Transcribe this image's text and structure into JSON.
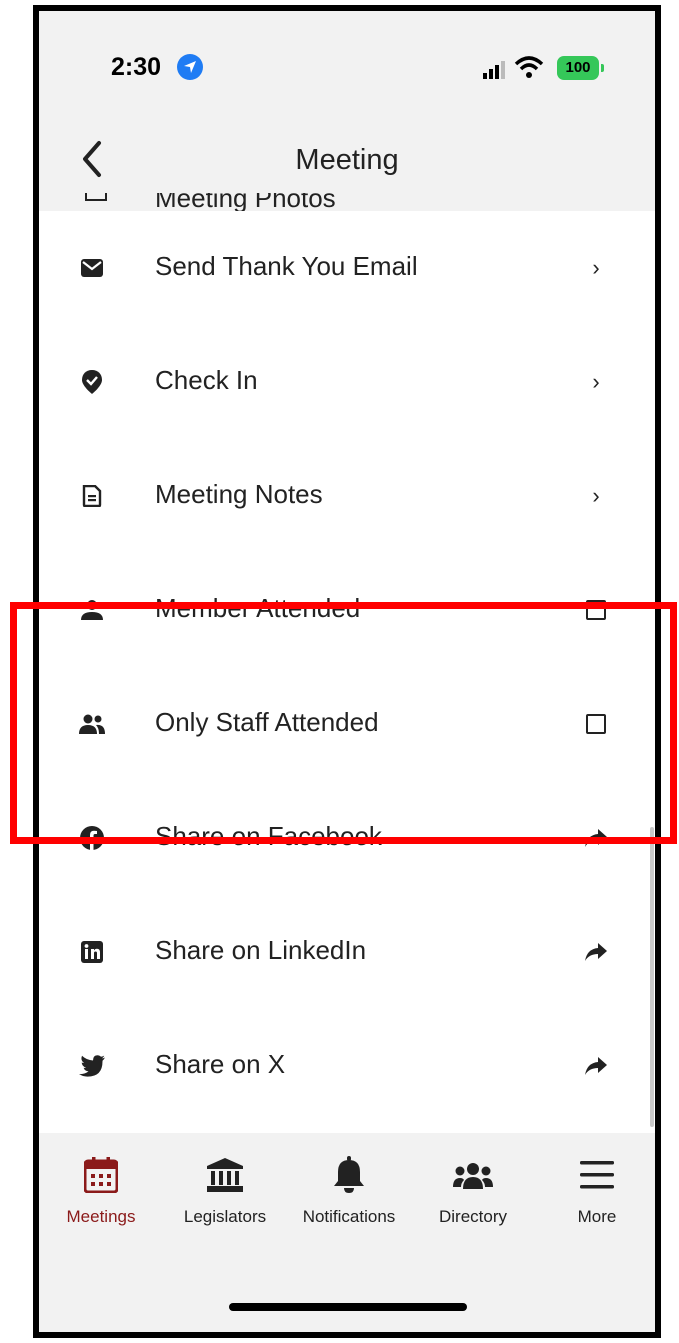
{
  "status_bar": {
    "time": "2:30",
    "battery": "100"
  },
  "nav": {
    "title": "Meeting",
    "partial_item": "Meeting Photos"
  },
  "items": [
    {
      "label": "Send Thank You Email",
      "icon": "envelope-icon",
      "trailing": "chevron"
    },
    {
      "label": "Check In",
      "icon": "location-pin-check-icon",
      "trailing": "chevron"
    },
    {
      "label": "Meeting Notes",
      "icon": "document-icon",
      "trailing": "chevron"
    },
    {
      "label": "Member Attended",
      "icon": "person-icon",
      "trailing": "checkbox",
      "checked": false
    },
    {
      "label": "Only Staff Attended",
      "icon": "people-icon",
      "trailing": "checkbox",
      "checked": false
    },
    {
      "label": "Share on Facebook",
      "icon": "facebook-icon",
      "trailing": "share"
    },
    {
      "label": "Share on LinkedIn",
      "icon": "linkedin-icon",
      "trailing": "share"
    },
    {
      "label": "Share on X",
      "icon": "twitter-bird-icon",
      "trailing": "share"
    }
  ],
  "tabs": [
    {
      "label": "Meetings",
      "icon": "calendar-icon",
      "active": true
    },
    {
      "label": "Legislators",
      "icon": "capitol-building-icon",
      "active": false
    },
    {
      "label": "Notifications",
      "icon": "bell-icon",
      "active": false
    },
    {
      "label": "Directory",
      "icon": "group-icon",
      "active": false
    },
    {
      "label": "More",
      "icon": "hamburger-menu-icon",
      "active": false
    }
  ],
  "colors": {
    "accent": "#8b1a1a",
    "highlight": "#ff0000",
    "location": "#1f7cf4",
    "battery": "#35c759"
  }
}
